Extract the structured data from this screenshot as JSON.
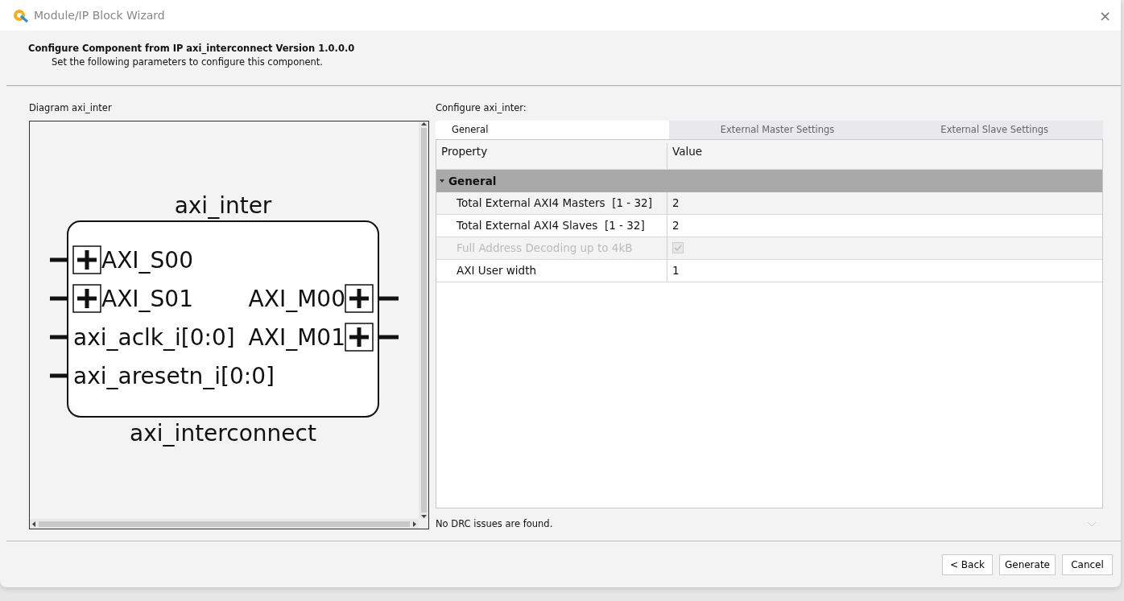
{
  "window": {
    "title": "Module/IP Block Wizard",
    "close": "×"
  },
  "header": {
    "title": "Configure Component from IP axi_interconnect Version 1.0.0.0",
    "subtitle": "Set the following parameters to configure this component."
  },
  "diagram": {
    "label": "Diagram axi_inter",
    "instance_name": "axi_inter",
    "module_name": "axi_interconnect",
    "left_ports": [
      {
        "label": "AXI_S00",
        "kind": "bus"
      },
      {
        "label": "AXI_S01",
        "kind": "bus"
      },
      {
        "label": "axi_aclk_i[0:0]",
        "kind": "wire"
      },
      {
        "label": "axi_aresetn_i[0:0]",
        "kind": "wire"
      }
    ],
    "right_ports": [
      {
        "label": "AXI_M00",
        "kind": "bus"
      },
      {
        "label": "AXI_M01",
        "kind": "bus"
      }
    ]
  },
  "config": {
    "label": "Configure axi_inter:",
    "tabs": [
      {
        "label": "General",
        "selected": true
      },
      {
        "label": "External Master Settings",
        "selected": false
      },
      {
        "label": "External Slave Settings",
        "selected": false
      }
    ],
    "columns": [
      "Property",
      "Value"
    ],
    "groups": [
      {
        "label": "General",
        "expanded": true,
        "rows": [
          {
            "property": "Total External AXI4 Masters  [1 - 32]",
            "kind": "text",
            "value": "2",
            "disabled": false
          },
          {
            "property": "Total External AXI4 Slaves  [1 - 32]",
            "kind": "text",
            "value": "2",
            "disabled": false
          },
          {
            "property": "Full Address Decoding up to 4kB",
            "kind": "checkbox",
            "checked": true,
            "disabled": true
          },
          {
            "property": "AXI User width",
            "kind": "text",
            "value": "1",
            "disabled": false
          }
        ]
      }
    ],
    "status": "No DRC issues are found."
  },
  "buttons": [
    "< Back",
    "Generate",
    "Cancel"
  ]
}
